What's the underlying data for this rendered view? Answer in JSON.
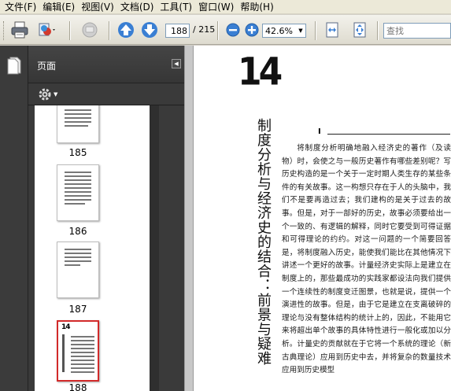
{
  "menubar": {
    "items": [
      "文件(F)",
      "编辑(E)",
      "视图(V)",
      "文档(D)",
      "工具(T)",
      "窗口(W)",
      "帮助(H)"
    ]
  },
  "toolbar": {
    "current_page": "188",
    "total_pages": "/ 215",
    "zoom": "42.6%",
    "search_placeholder": "查找"
  },
  "panel": {
    "title": "页面",
    "thumbnails": [
      {
        "label": "185"
      },
      {
        "label": "186"
      },
      {
        "label": "187"
      },
      {
        "label": "188"
      }
    ]
  },
  "document": {
    "chapter_number": "14",
    "chapter_title": "制度分析与经济史的结合：前景与疑难",
    "section_marker": "I",
    "body": "将制度分析明确地融入经济史的著作（及读物）时，会使之与一般历史著作有哪些差别呢？写历史构造的是一个关于一定时期人类生存的某些条件的有关故事。这一构想只存在于人的头脑中，我们不是要再造过去；我们建构的是关于过去的故事。但是，对于一部好的历史，故事必须要给出一个一致的、有逻辑的解释，同时它要受到可得证据和可得理论的约约。对这一问题的一个简要回答是，将制度融入历史，能使我们能比在其他情况下讲述一个更好的故事。计量经济史实际上是建立在制度上的，那些最成功的实践家都设法向我们提供一个连续性的制度变迁图景，也就是说，提供一个演进性的故事。但是，由于它是建立在支离破碎的理论与没有整体结构的统计上的，因此，不能用它来将超出单个故事的具体特性进行一般化或加以分析。计量史的贡献就在于它将一个系统的理论（新古典理论）应用到历史中去，并将复杂的数量技术应用到历史模型"
  }
}
